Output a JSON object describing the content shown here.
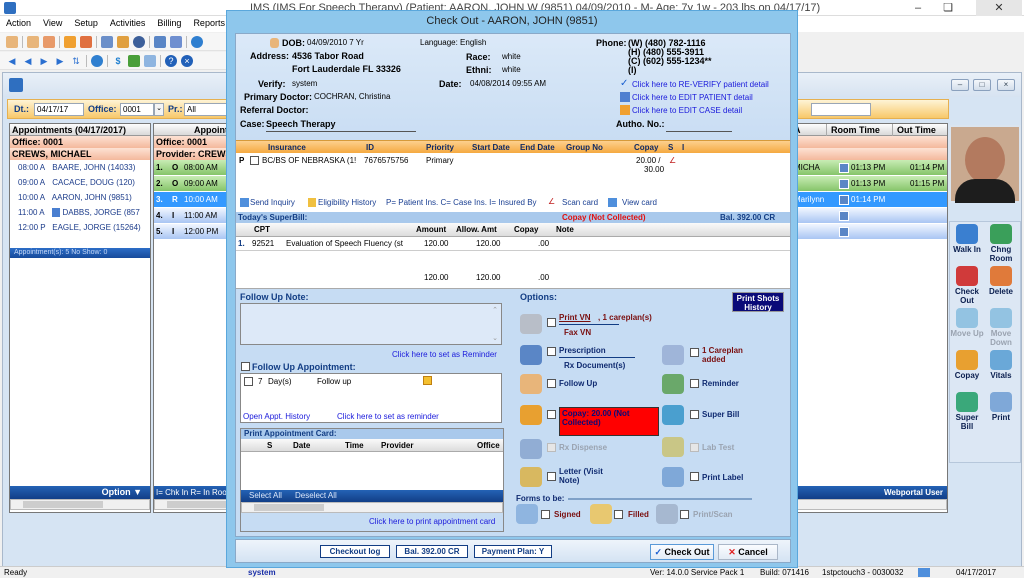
{
  "app": {
    "title": "IMS (IMS  For Speech Therapy)     (Patient: AARON, JOHN W (9851) 04/09/2010 - M- Age: 7y 1w - 203 lbs on 04/17/17)",
    "window_controls": {
      "minimize": "–",
      "restore": "❏",
      "close": "✕"
    }
  },
  "menu": [
    "Action",
    "View",
    "Setup",
    "Activities",
    "Billing",
    "Reports"
  ],
  "toolbar1_icons": [
    "patient-icon",
    "patient-edit-icon",
    "patient-verify-icon",
    "folder-icon",
    "edit-note-icon",
    "rx-icon",
    "lab-flask-icon",
    "shield-icon",
    "superbill-icon",
    "notepad-icon",
    "refresh-icon"
  ],
  "toolbar2_icons": [
    "first-record-icon",
    "prev-record-icon",
    "next-record-icon",
    "last-record-icon",
    "sort-icon",
    "sync-icon",
    "dollar-icon",
    "report-chart-icon",
    "settings-icon",
    "help-icon",
    "close-circle-icon"
  ],
  "filter": {
    "date_label": "Dt.:",
    "date_value": "04/17/17",
    "office_label": "Office:",
    "office_value": "0001",
    "provider_label": "Pr.:",
    "provider_value": "All"
  },
  "appointments": {
    "header": "Appointments (04/17/2017)",
    "office": "Office: 0001",
    "provider": "CREWS, MICHAEL",
    "rows": [
      {
        "time": "08:00 A",
        "name": "BAARE, JOHN  (14033)"
      },
      {
        "time": "09:00 A",
        "name": "CACACE, DOUG  (120)"
      },
      {
        "time": "10:00 A",
        "name": "AARON, JOHN  (9851)"
      },
      {
        "time": "11:00 A",
        "name": "DABBS, JORGE  (857"
      },
      {
        "time": "12:00 P",
        "name": "EAGLE, JORGE  (15264)"
      }
    ],
    "footer": "Appointment(s): 5   No Show: 0",
    "option_label": "Option ▼"
  },
  "schedule": {
    "header": "Appointme",
    "office": "Office: 0001",
    "provider": "Provider: CREWS",
    "col_room_time": "Room Time",
    "col_out_time": "Out Time",
    "col_partial": "A",
    "rows": [
      {
        "num": "1.",
        "status": "O",
        "time": "08:00 AM",
        "name_tail": "MICHA",
        "room_time": "01:13 PM",
        "out_time": "01:14 PM"
      },
      {
        "num": "2.",
        "status": "O",
        "time": "09:00 AM",
        "name_tail": "y",
        "room_time": "01:13 PM",
        "out_time": "01:15 PM"
      },
      {
        "num": "3.",
        "status": "R",
        "time": "10:00 AM",
        "name_tail": "Marilynn",
        "room_time": "01:14 PM",
        "out_time": ""
      },
      {
        "num": "4.",
        "status": "I",
        "time": "11:00 AM",
        "name_tail": "",
        "room_time": "",
        "out_time": ""
      },
      {
        "num": "5.",
        "status": "I",
        "time": "12:00 PM",
        "name_tail": "",
        "room_time": "",
        "out_time": ""
      }
    ],
    "legend": "I= Chk In  R= In Room",
    "webportal": "Webportal User"
  },
  "side_tools": [
    {
      "label": "Walk In",
      "icon": "walk-in-icon",
      "enabled": true
    },
    {
      "label": "Chng Room",
      "icon": "change-room-icon",
      "enabled": true
    },
    {
      "label": "Check Out",
      "icon": "check-out-icon",
      "enabled": true
    },
    {
      "label": "Delete",
      "icon": "delete-icon",
      "enabled": true
    },
    {
      "label": "Move Up",
      "icon": "move-up-icon",
      "enabled": false
    },
    {
      "label": "Move Down",
      "icon": "move-down-icon",
      "enabled": false
    },
    {
      "label": "Copay",
      "icon": "copay-icon",
      "enabled": true
    },
    {
      "label": "Vitals",
      "icon": "vitals-icon",
      "enabled": true
    },
    {
      "label": "Super Bill",
      "icon": "super-bill-icon",
      "enabled": true
    },
    {
      "label": "Print",
      "icon": "print-icon",
      "enabled": true
    }
  ],
  "status_bar": {
    "ready": "Ready",
    "user": "system",
    "version": "Ver: 14.0.0 Service Pack 1",
    "build": "Build: 071416",
    "station": "1stpctouch3 - 0030032",
    "date": "04/17/2017"
  },
  "dialog": {
    "title": "Check Out - AARON, JOHN  (9851)",
    "patient": {
      "dob_label": "DOB:",
      "dob": "04/09/2010 7 Yr",
      "language": "Language: English",
      "address_label": "Address:",
      "address1": "4536 Tabor Road",
      "address2": "Fort Lauderdale  FL  33326",
      "race_label": "Race:",
      "race": "white",
      "ethni_label": "Ethni:",
      "ethni": "white",
      "phone_label": "Phone:",
      "phones": [
        "(W)  (480) 782-1116",
        "(H)  (480) 555-3911",
        "(C)  (602) 555-1234**",
        "(I)"
      ],
      "verify_label": "Verify:",
      "verify": "system",
      "date_label": "Date:",
      "date": "04/08/2014 09:55 AM",
      "primary_doctor_label": "Primary Doctor:",
      "primary_doctor": "COCHRAN, Christina",
      "referral_doctor_label": "Referral Doctor:",
      "case_label": "Case:",
      "case": "Speech Therapy",
      "autho_label": "Autho. No.:",
      "link_reverify": "Click here to RE-VERIFY patient detail",
      "link_edit_patient": "Click here to EDIT PATIENT detail",
      "link_edit_case": "Click here to EDIT CASE detail"
    },
    "insurance": {
      "columns": [
        "Insurance",
        "ID",
        "Priority",
        "Start Date",
        "End Date",
        "Group No",
        "Copay",
        "S",
        "I"
      ],
      "rows": [
        {
          "type": "P",
          "insurance": "BC/BS OF NEBRASKA  (1!",
          "id": "7676575756",
          "priority": "Primary",
          "start": "",
          "end": "",
          "group": "",
          "copay1": "20.00 /",
          "copay2": "30.00"
        }
      ],
      "links": [
        "Send Inquiry",
        "Eligibility History",
        "P= Patient Ins. C= Case Ins. I= Insured By",
        "Scan card",
        "View card"
      ]
    },
    "superbill": {
      "title": "Today's SuperBill:",
      "copay_status": "Copay (Not Collected)",
      "balance": "Bal. 392.00 CR",
      "columns": [
        "CPT",
        "Amount",
        "Allow. Amt",
        "Copay",
        "Note"
      ],
      "rows": [
        {
          "num": "1.",
          "cpt": "92521",
          "desc": "Evaluation of Speech Fluency (st",
          "amount": "120.00",
          "allow": "120.00",
          "copay": ".00",
          "note": ""
        }
      ],
      "totals": {
        "amount": "120.00",
        "allow": "120.00",
        "copay": ".00"
      }
    },
    "follow_up": {
      "note_title": "Follow Up Note:",
      "note_value": "",
      "reminder_link": "Click here to set as Reminder",
      "appt_title": "Follow Up Appointment:",
      "days": "7",
      "days_unit": "Day(s)",
      "reason": "Follow up",
      "history_link": "Open Appt. History",
      "reminder_link2": "Click here to set as reminder"
    },
    "appt_card": {
      "title": "Print Appointment Card:",
      "columns": [
        "S",
        "Date",
        "Time",
        "Provider",
        "Office"
      ],
      "select_all": "Select All",
      "deselect_all": "Deselect All",
      "print_link": "Click here to print appointment card"
    },
    "options": {
      "title": "Options:",
      "print_shots": "Print Shots History",
      "print_vn": "Print VN",
      "careplans": ", 1 careplan(s)",
      "fax_vn": "Fax VN",
      "prescription": "Prescription",
      "rx_documents": "Rx Document(s)",
      "careplan_added": "1 Careplan added",
      "follow_up": "Follow Up",
      "reminder": "Reminder",
      "copay": "Copay: 20.00 (Not Collected)",
      "super_bill": "Super Bill",
      "rx_dispense": "Rx Dispense",
      "lab_test": "Lab Test",
      "letter": "Letter (Visit Note)",
      "print_label": "Print Label",
      "forms_title": "Forms to be:",
      "signed": "Signed",
      "filled": "Filled",
      "print_scan": "Print/Scan"
    },
    "footer": {
      "checkout_log": "Checkout log",
      "balance": "Bal. 392.00 CR",
      "payment_plan": "Payment Plan: Y",
      "check_out": "Check Out",
      "cancel": "Cancel"
    }
  }
}
